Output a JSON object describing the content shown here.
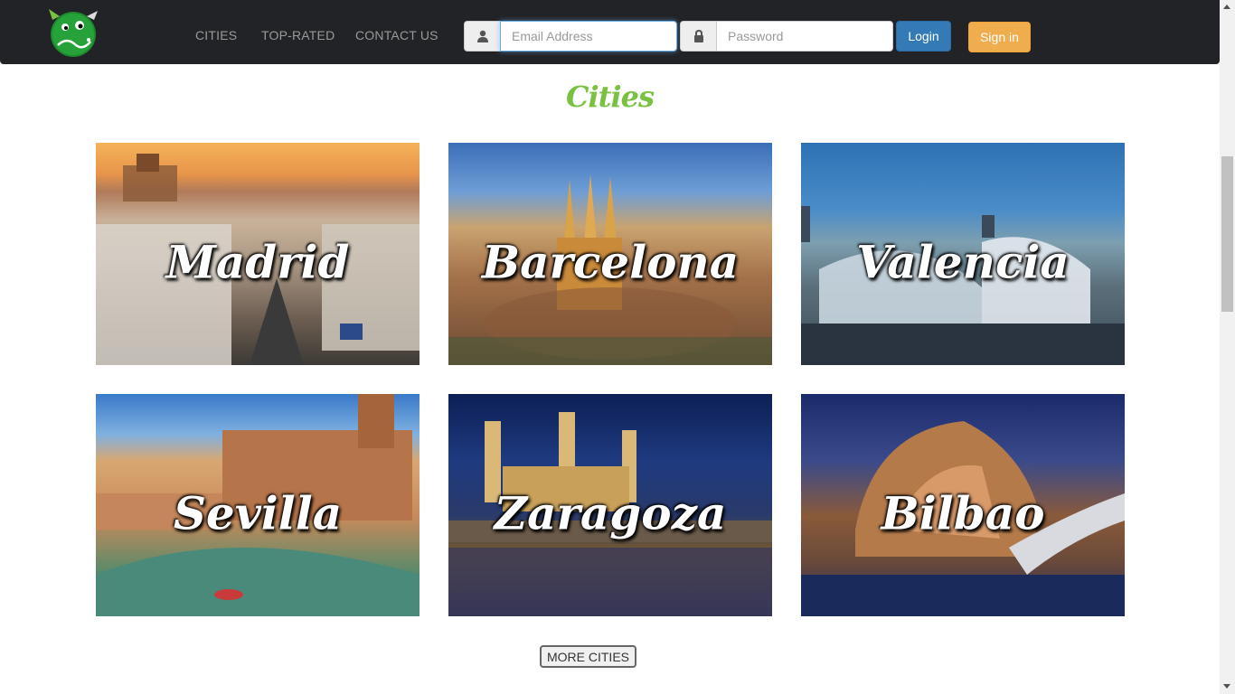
{
  "navbar": {
    "links": [
      "CITIES",
      "TOP-RATED",
      "CONTACT US"
    ],
    "email_placeholder": "Email Address",
    "password_placeholder": "Password",
    "login_label": "Login",
    "signin_label": "Sign in",
    "login_color": "#337ab7",
    "signin_color": "#f0ad4e"
  },
  "section": {
    "title": "Cities",
    "title_color": "#7ac142"
  },
  "cities": [
    {
      "name": "Madrid"
    },
    {
      "name": "Barcelona"
    },
    {
      "name": "Valencia"
    },
    {
      "name": "Sevilla"
    },
    {
      "name": "Zaragoza"
    },
    {
      "name": "Bilbao"
    }
  ],
  "more_button": "MORE CITIES"
}
